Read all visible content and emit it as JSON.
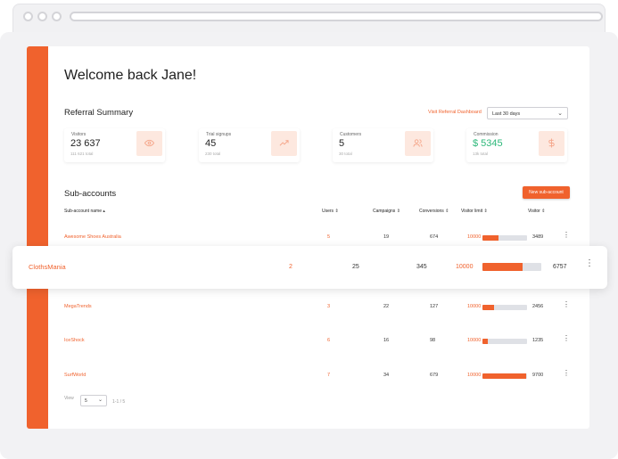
{
  "welcome": "Welcome back Jane!",
  "referral": {
    "title": "Referral Summary",
    "link": "Visit Referral Dashboard",
    "range": "Last 30 days",
    "stats": [
      {
        "label": "Visitors",
        "value": "23 637",
        "sub": "111 621 total",
        "icon": "eye-icon"
      },
      {
        "label": "Trial signups",
        "value": "45",
        "sub": "230 total",
        "icon": "trend-up-icon"
      },
      {
        "label": "Customers",
        "value": "5",
        "sub": "30 total",
        "icon": "users-icon"
      },
      {
        "label": "Commission",
        "value": "$ 5345",
        "sub": "13k total",
        "icon": "dollar-icon"
      }
    ]
  },
  "subaccounts": {
    "title": "Sub-accounts",
    "new_button": "New sub-account",
    "headers": {
      "name": "Sub-account name",
      "users": "Users",
      "campaigns": "Campaigns",
      "conversions": "Conversions",
      "limit": "Visitor limit",
      "visitor": "Visitor"
    },
    "rows": [
      {
        "name": "Awesome Shoes Australia",
        "users": "5",
        "campaigns": "19",
        "conversions": "674",
        "limit": "10000",
        "visitor": "3489",
        "progress": 0.35
      },
      {
        "name": "ClothsMania",
        "users": "2",
        "campaigns": "25",
        "conversions": "345",
        "limit": "10000",
        "visitor": "6757",
        "progress": 0.68
      },
      {
        "name": "MegaTrends",
        "users": "3",
        "campaigns": "22",
        "conversions": "127",
        "limit": "10000",
        "visitor": "2456",
        "progress": 0.25
      },
      {
        "name": "IceShock",
        "users": "6",
        "campaigns": "16",
        "conversions": "98",
        "limit": "10000",
        "visitor": "1235",
        "progress": 0.12
      },
      {
        "name": "SurfWorld",
        "users": "7",
        "campaigns": "34",
        "conversions": "679",
        "limit": "10000",
        "visitor": "9700",
        "progress": 0.97
      }
    ]
  },
  "pager": {
    "view_label": "View",
    "per_page": "5",
    "range": "1-1 / 5"
  },
  "colors": {
    "accent": "#f0622d",
    "green": "#2db87a"
  }
}
